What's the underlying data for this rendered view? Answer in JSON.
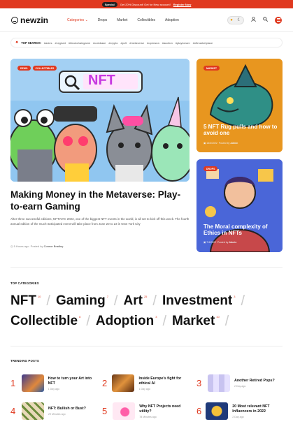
{
  "topbar": {
    "pill": "Special",
    "text": "Get 20% Discount! Get for New account!",
    "link": "Register Now"
  },
  "header": {
    "logo": "newzin",
    "nav": [
      {
        "label": "Categories",
        "active": true
      },
      {
        "label": "Drops"
      },
      {
        "label": "Market"
      },
      {
        "label": "Collectibles"
      },
      {
        "label": "Adoption"
      }
    ]
  },
  "search": {
    "label": "TOP SEARCH:",
    "tags": [
      "#axies",
      "#cryptart",
      "#blockchaingame",
      "#coinbase",
      "#crypto",
      "#pc5",
      "#metaverse",
      "#opensea",
      "#auction",
      "#playtoearn",
      "#nftmarketplace"
    ]
  },
  "hero": {
    "badges": [
      "DEMO",
      "COLLECTIBLES"
    ],
    "sign": "NFT",
    "title": "Making Money in the Metaverse: Play-to-earn Gaming",
    "excerpt": "After three successful editions, NFT.NYC 2022, one of the biggest NFT events in the world, is all set to kick off this week. The fourth annual edition of the much-anticipated event will take place from June 20 to 23 in New York City",
    "time": "5 Hours ago",
    "posted_by": "Posted by",
    "author": "Connor Bradley"
  },
  "side_cards": [
    {
      "badge": "MARKET",
      "title": "5 NFT Rug pulls and how to avoid one",
      "date": "16/4/2022",
      "by": "Posted by",
      "author": "Admin"
    },
    {
      "badge": "DROPS",
      "title": "The Moral complexity of Ethics in NFTs",
      "date": "7/4/2022",
      "by": "Posted by",
      "author": "Admin"
    }
  ],
  "top_categories": {
    "title": "TOP CATEGORIES",
    "items": [
      {
        "label": "NFT",
        "count": "10"
      },
      {
        "label": "Gaming",
        "count": "7"
      },
      {
        "label": "Art",
        "count": "25"
      },
      {
        "label": "Investment",
        "count": "3"
      },
      {
        "label": "Collectible",
        "count": "8"
      },
      {
        "label": "Adoption",
        "count": "3"
      },
      {
        "label": "Market",
        "count": "10"
      }
    ]
  },
  "trending": {
    "title": "TRENDING POSTS",
    "items": [
      {
        "num": "1",
        "title": "How to turn your Art into NFT",
        "meta": "1 Day ago"
      },
      {
        "num": "2",
        "title": "Inside Europe's fight for ethical AI",
        "meta": "1 Day ago"
      },
      {
        "num": "3",
        "title": "Another Retired Pops?",
        "meta": "2 Day ago"
      },
      {
        "num": "4",
        "title": "NFT: Bullish or Bust?",
        "meta": "29 Minutes ago"
      },
      {
        "num": "5",
        "title": "Why NFT Projects need utility?",
        "meta": "78 Minutes ago"
      },
      {
        "num": "6",
        "title": "20 Most relevant NFT Influencers in 2022",
        "meta": "2 Day ago"
      }
    ]
  },
  "colors": {
    "accent": "#e0391f"
  }
}
